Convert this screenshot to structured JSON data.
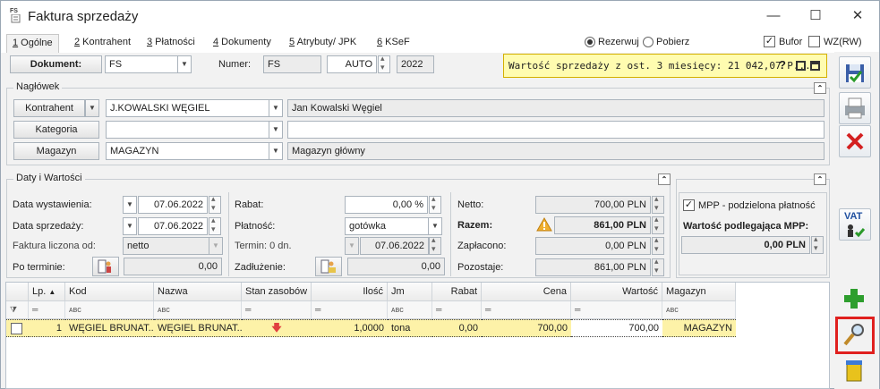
{
  "window": {
    "title": "Faktura sprzedaży",
    "icon_text": "FS",
    "minimize": "—",
    "maximize": "☐",
    "close": "✕"
  },
  "tabs": [
    {
      "key": "1",
      "label": " Ogólne"
    },
    {
      "key": "2",
      "label": " Kontrahent"
    },
    {
      "key": "3",
      "label": " Płatności"
    },
    {
      "key": "4",
      "label": " Dokumenty"
    },
    {
      "key": "5",
      "label": " Atrybuty/ JPK"
    },
    {
      "key": "6",
      "label": " KSeF"
    }
  ],
  "options": {
    "rezerwuj": "Rezerwuj",
    "pobierz": "Pobierz",
    "bufor": "Bufor",
    "wz": "WZ(RW)",
    "selected_radio": "Rezerwuj",
    "bufor_checked": true,
    "wz_checked": false
  },
  "document": {
    "label": "Dokument:",
    "type": "FS",
    "numer_label": "Numer:",
    "numer_prefix": "FS",
    "numer_mode": "AUTO",
    "year": "2022"
  },
  "info_banner": {
    "text": "Wartość sprzedaży z ost. 3 miesięcy: 21 042,07 P...",
    "help": "?"
  },
  "naglowek": {
    "title": "Nagłówek",
    "kontrahent_btn": "Kontrahent",
    "kontrahent_code": "J.KOWALSKI  WĘGIEL",
    "kontrahent_name": "Jan Kowalski  Węgiel",
    "kategoria_btn": "Kategoria",
    "kategoria_code": "",
    "kategoria_name": "",
    "magazyn_btn": "Magazyn",
    "magazyn_code": "MAGAZYN",
    "magazyn_name": "Magazyn główny"
  },
  "daty": {
    "title": "Daty i Wartości",
    "data_wystawienia_label": "Data wystawienia:",
    "data_wystawienia": "07.06.2022",
    "data_sprzedazy_label": "Data sprzedaży:",
    "data_sprzedazy": "07.06.2022",
    "liczona_label": "Faktura liczona od:",
    "liczona": "netto",
    "po_terminie_label": "Po terminie:",
    "po_terminie": "0,00",
    "rabat_label": "Rabat:",
    "rabat": "0,00 %",
    "platnosc_label": "Płatność:",
    "platnosc": "gotówka",
    "termin_label": "Termin: 0 dn.",
    "termin": "07.06.2022",
    "zadluzenie_label": "Zadłużenie:",
    "zadluzenie": "0,00",
    "netto_label": "Netto:",
    "netto": "700,00 PLN",
    "razem_label": "Razem:",
    "razem": "861,00 PLN",
    "zaplacono_label": "Zapłacono:",
    "zaplacono": "0,00 PLN",
    "pozostaje_label": "Pozostaje:",
    "pozostaje": "861,00 PLN"
  },
  "mpp": {
    "label": "MPP - podzielona płatność",
    "checked": true,
    "wartosc_label": "Wartość podlegająca MPP:",
    "wartosc": "0,00 PLN"
  },
  "grid": {
    "headers": {
      "lp": "Lp.",
      "kod": "Kod",
      "nazwa": "Nazwa",
      "stan": "Stan zasobów",
      "ilosc": "Ilość",
      "jm": "Jm",
      "rabat": "Rabat",
      "cena": "Cena",
      "wartosc": "Wartość",
      "magazyn": "Magazyn"
    },
    "filter_eq": "═",
    "filter_abc": "ᴀʙc",
    "rows": [
      {
        "lp": "1",
        "kod": "WĘGIEL BRUNAT...",
        "nazwa": "WĘGIEL BRUNAT...",
        "stan": "🡇",
        "ilosc": "1,0000",
        "jm": "tona",
        "rabat": "0,00",
        "cena": "700,00",
        "wartosc": "700,00",
        "magazyn": "MAGAZYN"
      }
    ]
  },
  "icons": {
    "save": "save-icon",
    "print": "printer-icon",
    "cancel": "close-red-icon",
    "vat": "VAT",
    "add": "plus-icon",
    "edit": "magnifier-icon",
    "delete": "trash-icon"
  },
  "colors": {
    "banner_bg": "#fffcb0",
    "banner_border": "#d4b000",
    "row_highlight": "#fdf2a8",
    "highlight_box": "#e0201e",
    "add_green": "#2e9e2e",
    "cancel_red": "#d42020"
  }
}
